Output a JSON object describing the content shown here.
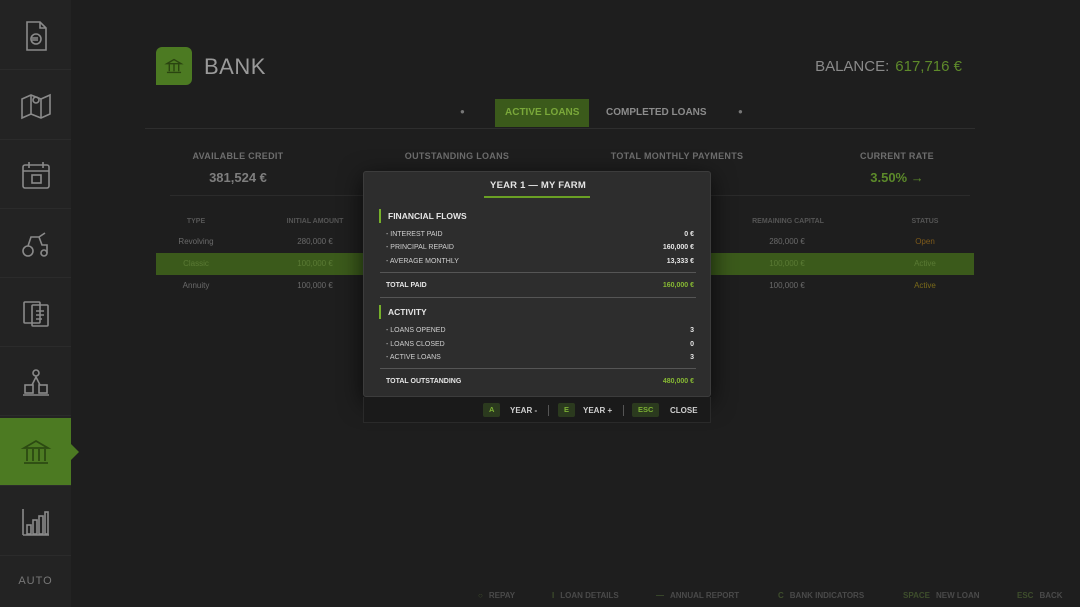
{
  "sidebar": {
    "items": [
      {
        "icon": "document-euro-icon"
      },
      {
        "icon": "map-icon"
      },
      {
        "icon": "calendar-icon"
      },
      {
        "icon": "tractor-icon"
      },
      {
        "icon": "contracts-icon"
      },
      {
        "icon": "production-icon"
      },
      {
        "icon": "bank-icon",
        "active": true
      },
      {
        "icon": "statistics-chart-icon"
      }
    ],
    "more_label": "AUTO"
  },
  "header": {
    "title": "BANK",
    "balance_label": "BALANCE:",
    "balance_value": "617,716 €"
  },
  "tabs": [
    {
      "label": "ACTIVE LOANS",
      "active": true
    },
    {
      "label": "COMPLETED LOANS",
      "active": false
    }
  ],
  "stats": [
    {
      "label": "AVAILABLE CREDIT",
      "sub": "",
      "value": "381,524 €"
    },
    {
      "label": "OUTSTANDING LOANS",
      "sub": "",
      "value": ""
    },
    {
      "label": "TOTAL MONTHLY PAYMENTS",
      "sub": "",
      "value": ""
    },
    {
      "label": "CURRENT RATE",
      "sub": "",
      "value": "3.50% →"
    }
  ],
  "loans_table": {
    "headers": [
      "TYPE",
      "INITIAL AMOUNT",
      "",
      "",
      "",
      "REMAINING CAPITAL",
      "STATUS"
    ],
    "rows": [
      {
        "type": "Revolving",
        "initial": "280,000 €",
        "remaining": "280,000 €",
        "status": "Open"
      },
      {
        "type": "Classic",
        "initial": "100,000 €",
        "remaining": "100,000 €",
        "status": "Active"
      },
      {
        "type": "Annuity",
        "initial": "100,000 €",
        "remaining": "100,000 €",
        "status": "Active"
      }
    ]
  },
  "footer_hints": [
    {
      "key": "○",
      "label": "REPAY"
    },
    {
      "key": "I",
      "label": "LOAN DETAILS"
    },
    {
      "key": "—",
      "label": "ANNUAL REPORT"
    },
    {
      "key": "C",
      "label": "BANK INDICATORS"
    },
    {
      "key": "SPACE",
      "label": "NEW LOAN"
    },
    {
      "key": "ESC",
      "label": "BACK"
    }
  ],
  "modal": {
    "title": "YEAR 1 — MY FARM",
    "financial": {
      "heading": "FINANCIAL FLOWS",
      "rows": [
        {
          "label": "- INTEREST PAID",
          "value": "0 €"
        },
        {
          "label": "- PRINCIPAL REPAID",
          "value": "160,000 €"
        },
        {
          "label": "- AVERAGE MONTHLY",
          "value": "13,333 €"
        }
      ],
      "total_label": "TOTAL PAID",
      "total_value": "160,000 €"
    },
    "activity": {
      "heading": "ACTIVITY",
      "rows": [
        {
          "label": "- LOANS OPENED",
          "value": "3"
        },
        {
          "label": "- LOANS CLOSED",
          "value": "0"
        },
        {
          "label": "- ACTIVE LOANS",
          "value": "3"
        }
      ],
      "total_label": "TOTAL OUTSTANDING",
      "total_value": "480,000 €"
    },
    "footer": {
      "prev_key": "A",
      "prev_label": "YEAR -",
      "next_key": "E",
      "next_label": "YEAR +",
      "close_key": "ESC",
      "close_label": "CLOSE"
    }
  },
  "colors": {
    "accent": "#76b02a",
    "accent_dark": "#4c7a22",
    "modal_bg": "#2d2d2d",
    "page_bg": "#1e1e1e"
  }
}
